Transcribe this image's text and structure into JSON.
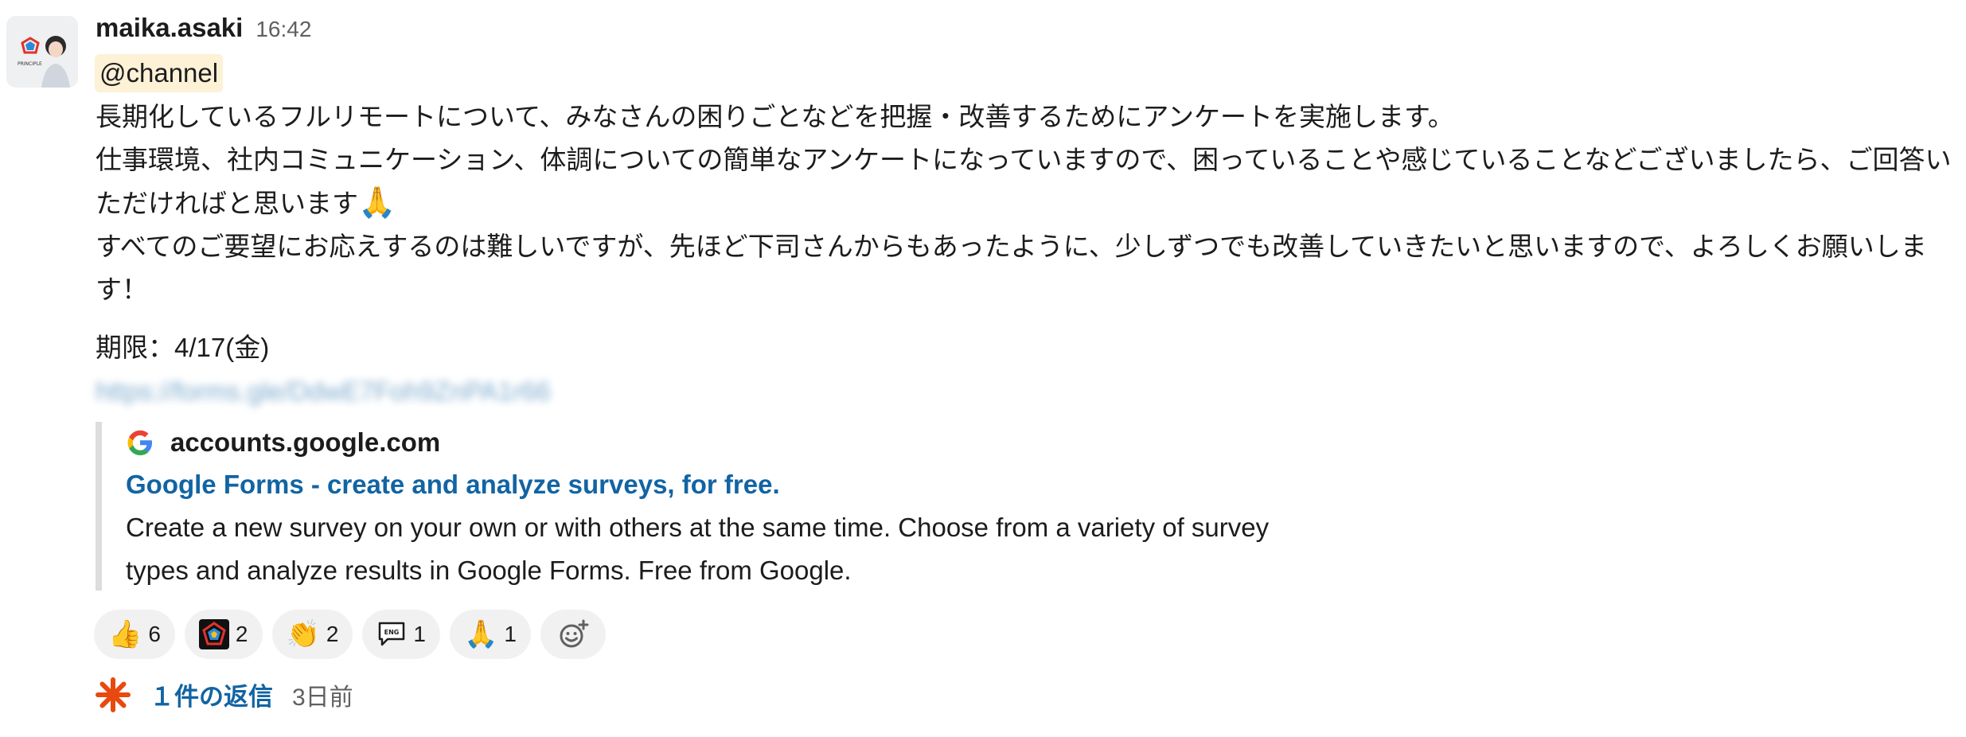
{
  "message": {
    "author": "maika.asaki",
    "time": "16:42",
    "avatar_text": "PRINCIPLE",
    "mention": "@channel",
    "lines": [
      "長期化しているフルリモートについて、みなさんの困りごとなどを把握・改善するためにアンケートを実施します。",
      "仕事環境、社内コミュニケーション、体調についての簡単なアンケートになっていますので、困っていることや感じていることなどございましたら、ご回答いただければと思います",
      "すべてのご要望にお応えするのは難しいですが、先ほど下司さんからもあったように、少しずつでも改善していきたいと思いますので、よろしくお願いします！"
    ],
    "pray_emoji": "🙏",
    "deadline": "期限：4/17(金)",
    "link": "https://forms.gle/DdwE7Foh9ZnPA1r66"
  },
  "unfurl": {
    "site": "accounts.google.com",
    "title": "Google Forms - create and analyze surveys, for free.",
    "description": "Create a new survey on your own or with others at the same time. Choose from a variety of survey types and analyze results in Google Forms. Free from Google."
  },
  "reactions": [
    {
      "emoji": "👍",
      "count": "6",
      "icon": "thumbs-up-icon"
    },
    {
      "emoji": "",
      "count": "2",
      "icon": "principle-logo-icon"
    },
    {
      "emoji": "👏",
      "count": "2",
      "icon": "clap-icon"
    },
    {
      "emoji": "💬",
      "count": "1",
      "icon": "eng-speech-bubble-icon"
    },
    {
      "emoji": "🙏",
      "count": "1",
      "icon": "pray-icon"
    }
  ],
  "thread": {
    "replies": "１件の返信",
    "ago": "3日前"
  },
  "colors": {
    "link": "#1264a3",
    "mention_bg": "#fdf1d6",
    "quote_bar": "#dddddd",
    "reaction_bg": "#f1f1f1",
    "thread_icon": "#e8490f"
  }
}
